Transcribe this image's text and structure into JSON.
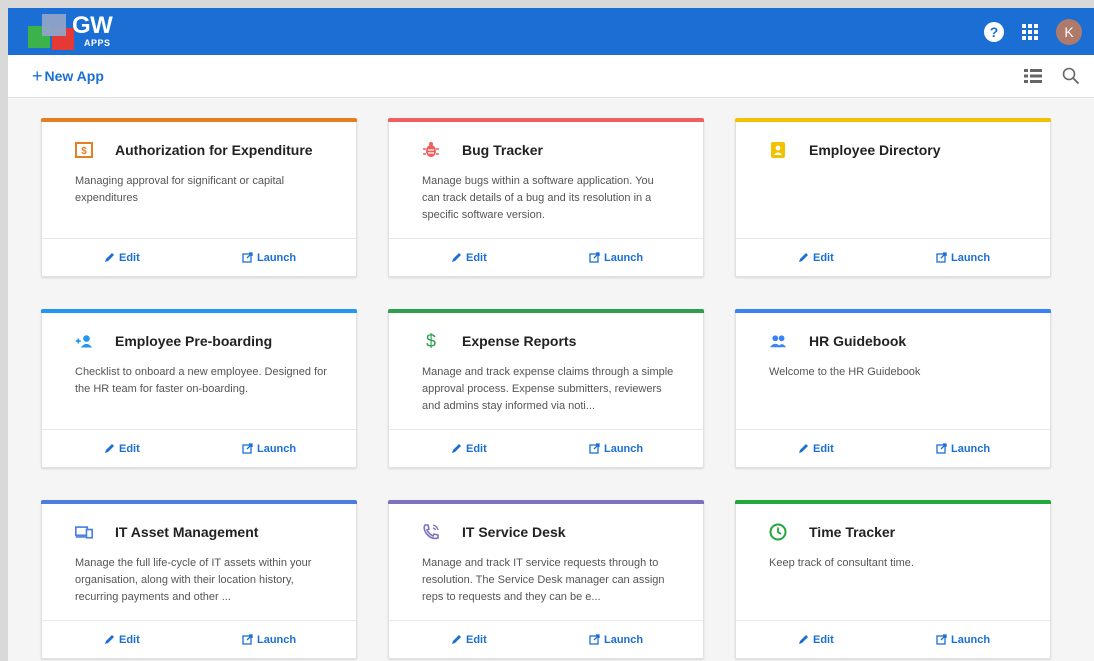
{
  "header": {
    "brand": "GW",
    "brand_sub": "APPS",
    "help_label": "?",
    "avatar_initial": "K",
    "accent_color": "#1b6fd4"
  },
  "toolbar": {
    "new_app_plus": "+",
    "new_app_label": "New App"
  },
  "card_actions": {
    "edit_label": "Edit",
    "launch_label": "Launch"
  },
  "cards": [
    {
      "title": "Authorization for Expenditure",
      "description": "Managing approval for significant or capital expenditures",
      "accent": "#e67e22",
      "icon": "dollar-box-icon"
    },
    {
      "title": "Bug Tracker",
      "description": "Manage bugs within a software application. You can track details of a bug and its resolution in a specific software version.",
      "accent": "#ef5f5f",
      "icon": "bug-icon"
    },
    {
      "title": "Employee Directory",
      "description": "",
      "accent": "#f2c200",
      "icon": "contact-card-icon"
    },
    {
      "title": "Employee Pre-boarding",
      "description": "Checklist to onboard a new employee. Designed for the HR team for faster on-boarding.",
      "accent": "#2196f3",
      "icon": "add-person-icon"
    },
    {
      "title": "Expense Reports",
      "description": "Manage and track expense claims through a simple approval process. Expense submitters, reviewers and admins stay informed via noti...",
      "accent": "#2e9e4f",
      "icon": "dollar-sign-icon"
    },
    {
      "title": "HR Guidebook",
      "description": "Welcome to the HR Guidebook",
      "accent": "#3b82f6",
      "icon": "people-icon"
    },
    {
      "title": "IT Asset Management",
      "description": "Manage the full life-cycle of IT assets within your organisation, along with their location history, recurring payments and other ...",
      "accent": "#4a7fe0",
      "icon": "devices-icon"
    },
    {
      "title": "IT Service Desk",
      "description": "Manage and track IT service requests through to resolution. The Service Desk manager can assign reps to requests and they can be e...",
      "accent": "#7e72c0",
      "icon": "phone-call-icon"
    },
    {
      "title": "Time Tracker",
      "description": "Keep track of consultant time.",
      "accent": "#22a73d",
      "icon": "clock-icon"
    }
  ]
}
